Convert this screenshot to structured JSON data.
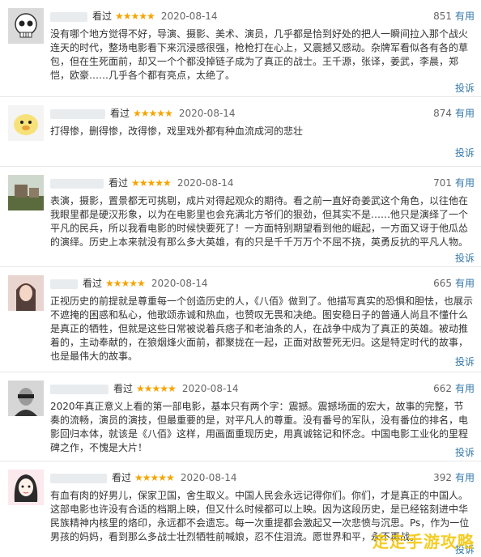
{
  "reviews": [
    {
      "seen": "看过",
      "stars": "★★★★★",
      "date": "2020-08-14",
      "votes": "851",
      "useful": "有用",
      "content": "没有哪个地方觉得不好，导演、摄影、美术、演员，几乎都是恰到好处的把人一瞬间拉入那个战火连天的时代，整场电影看下来沉浸感很强，枪枪打在心上，又震撼又感动。杂牌军看似各有各的草包，但在生死面前，却又一个个都没掉链子成为了真正的战士。王千源，张译，姜武，李晨，郑恺，欧豪……几乎各个都有亮点，太绝了。",
      "report": "投诉"
    },
    {
      "seen": "看过",
      "stars": "★★★★★",
      "date": "2020-08-14",
      "votes": "874",
      "useful": "有用",
      "content": "打得惨，删得惨，改得惨，戏里戏外都有种血流成河的悲壮",
      "report": "投诉"
    },
    {
      "seen": "看过",
      "stars": "★★★★★",
      "date": "2020-08-14",
      "votes": "701",
      "useful": "有用",
      "content": "表演，摄影，置景都无可挑剔，成片对得起观众的期待。看之前一直好奇姜武这个角色，以往他在我眼里都是硬汉形象，以为在电影里也会充满北方爷们的狠劲，但其实不是……他只是演绎了一个平凡的民兵，所以我看电影的时候快要死了！一方面特别期望看到他的崛起，一方面又讶于他瓜怂的演绎。历史上本来就没有那么多大英雄，有的只是千千万万个不屈不挠，英勇反抗的平凡人物。",
      "report": "投诉"
    },
    {
      "seen": "看过",
      "stars": "★★★★★",
      "date": "2020-08-14",
      "votes": "665",
      "useful": "有用",
      "content": "正视历史的前提就是尊重每一个创造历史的人，《八佰》做到了。他描写真实的恐惧和胆怯，也展示不遮掩的困惑和私心，他歌颂赤诚和热血，也赞叹无畏和决绝。图安稳日子的普通人尚且不懂什么是真正的牺牲，但就是这些日常被说着兵痞子和老油条的人，在战争中成为了真正的英雄。被动推着的，主动奉献的，在狼烟烽火面前，都聚拢在一起，正面对敌誓死无归。这是特定时代的故事，也是最伟大的故事。",
      "report": "投诉"
    },
    {
      "seen": "看过",
      "stars": "★★★★★",
      "date": "2020-08-14",
      "votes": "662",
      "useful": "有用",
      "content": "2020年真正意义上看的第一部电影，基本只有两个字：震撼。震撼场面的宏大，故事的完整，节奏的流畅，演员的演技，但最重要的是，对平凡人的尊重。没有番号的军队，没有番位的排名，电影回归本体，就该是《八佰》这样，用画面重现历史，用真诚铭记和怀念。中国电影工业化的里程碑之作，不愧是大片！",
      "report": "投诉"
    },
    {
      "seen": "看过",
      "stars": "★★★★★",
      "date": "2020-08-14",
      "votes": "392",
      "useful": "有用",
      "content": "有血有肉的好男儿，保家卫国，舍生取义。中国人民会永远记得你们。你们，才是真正的中国人。这部电影也许没有合适的档期上映，但又什么时候都可以上映。因为这段历史，是已经铭刻进中华民族精神内核里的烙印，永远都不会遗忘。每一次重提都会激起又一次悲愤与沉思。Ps，作为一位男孩的妈妈，看到那么多战士壮烈牺牲前喊娘，忍不住泪流。愿世界和平，永不再战。",
      "report": "投诉"
    }
  ],
  "watermark": "走走手游攻略",
  "colors": {
    "star": "#f7a400",
    "link": "#3377aa",
    "watermark": "#f3c400"
  }
}
